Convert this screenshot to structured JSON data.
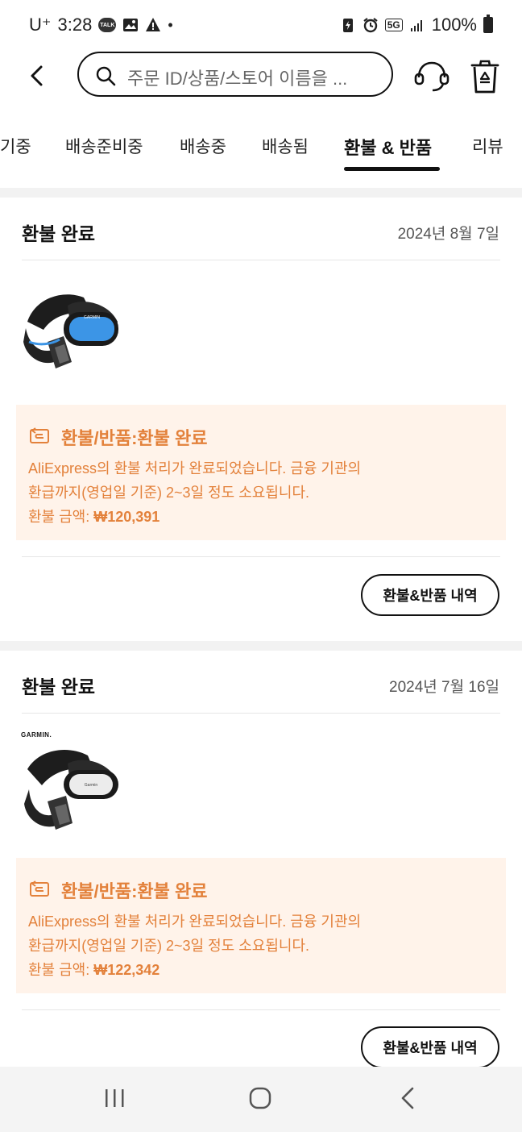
{
  "status_bar": {
    "time": "3:28",
    "carrier": "U⁺",
    "network": "5G",
    "battery": "100%"
  },
  "search": {
    "placeholder": "주문 ID/상품/스토어 이름을 ..."
  },
  "tabs": [
    {
      "label": "기중",
      "active": false
    },
    {
      "label": "배송준비중",
      "active": false
    },
    {
      "label": "배송중",
      "active": false
    },
    {
      "label": "배송됨",
      "active": false
    },
    {
      "label": "환불 & 반품",
      "active": true
    },
    {
      "label": "리뷰",
      "active": false
    }
  ],
  "orders": [
    {
      "status": "환불 완료",
      "date": "2024년 8월 7일",
      "notice_title": "환불/반품:환불 완료",
      "notice_line1": "AliExpress의 환불 처리가 완료되었습니다. 금융 기관의",
      "notice_line2": "환급까지(영업일 기준) 2~3일 정도 소요됩니다.",
      "amount_label": "환불 금액: ",
      "amount": "₩120,391",
      "button": "환불&반품 내역",
      "product_color": "#2f86d9"
    },
    {
      "status": "환불 완료",
      "date": "2024년 7월 16일",
      "brand": "GARMIN.",
      "notice_title": "환불/반품:환불 완료",
      "notice_line1": "AliExpress의 환불 처리가 완료되었습니다. 금융 기관의",
      "notice_line2": "환급까지(영업일 기준) 2~3일 정도 소요됩니다.",
      "amount_label": "환불 금액: ",
      "amount": "₩122,342",
      "button": "환불&반품 내역",
      "product_color": "#e9e9e9"
    }
  ],
  "colors": {
    "accent": "#e3813b",
    "notice_bg": "#fff3ea"
  }
}
